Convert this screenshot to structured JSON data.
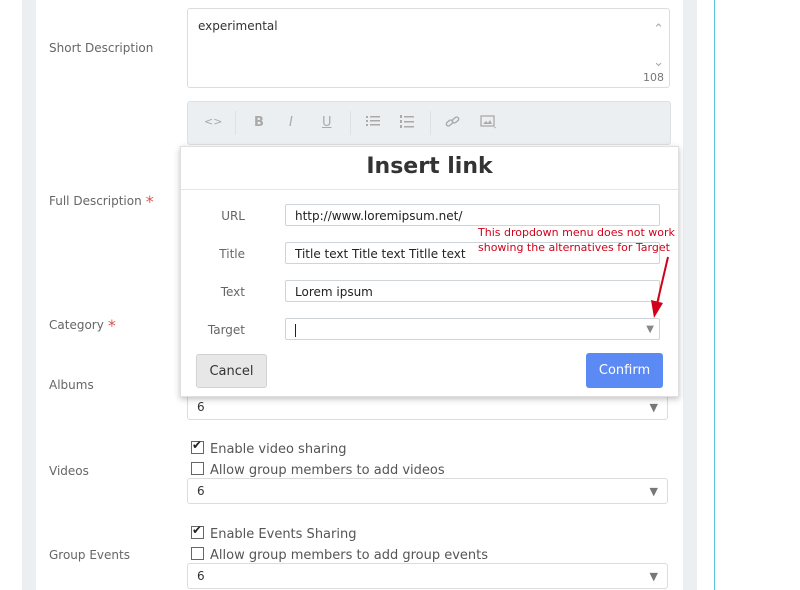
{
  "form": {
    "short_description": {
      "label": "Short Description",
      "value": "experimental",
      "counter": "108"
    },
    "full_description": {
      "label": "Full Description",
      "required_mark": "*"
    },
    "category": {
      "label": "Category",
      "required_mark": "*"
    },
    "albums": {
      "label": "Albums",
      "value": "6"
    },
    "videos": {
      "label": "Videos",
      "checkbox1": {
        "label": "Enable video sharing",
        "checked": true
      },
      "checkbox2": {
        "label": "Allow group members to add videos",
        "checked": false
      },
      "value": "6"
    },
    "group_events": {
      "label": "Group Events",
      "checkbox1": {
        "label": "Enable Events Sharing",
        "checked": true
      },
      "checkbox2": {
        "label": "Allow group members to add group events",
        "checked": false
      },
      "value": "6"
    }
  },
  "toolbar": {
    "icons": [
      "code-icon",
      "bold-icon",
      "italic-icon",
      "underline-icon",
      "bullet-list-icon",
      "numbered-list-icon",
      "link-icon",
      "image-icon"
    ],
    "code": "<>",
    "bold": "B",
    "italic": "I",
    "underline": "U"
  },
  "modal": {
    "title": "Insert link",
    "url_label": "URL",
    "url_value": "http://www.loremipsum.net/",
    "title_label": "Title",
    "title_value": "Title text Title text Titlle text",
    "text_label": "Text",
    "text_value": "Lorem ipsum",
    "target_label": "Target",
    "cancel": "Cancel",
    "confirm": "Confirm"
  },
  "annotation": {
    "line1": "This dropdown menu does not work",
    "line2": "showing the alternatives for Target",
    "color": "#d0021b"
  },
  "colors": {
    "accent": "#5b8af5",
    "required": "#d9534f"
  }
}
